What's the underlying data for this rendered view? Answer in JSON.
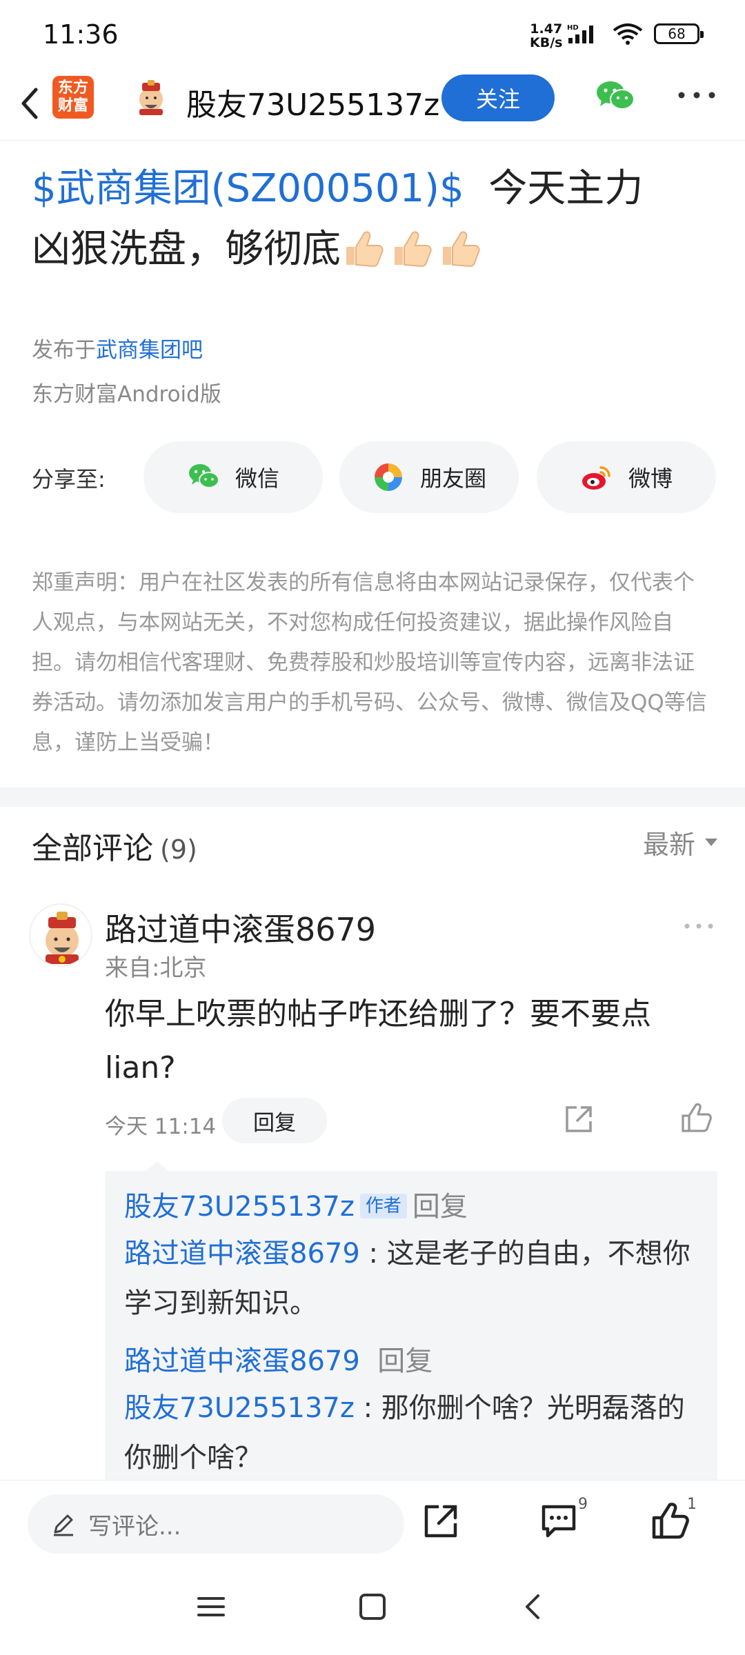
{
  "status": {
    "time": "11:36",
    "net_speed_value": "1.47",
    "net_speed_unit": "KB/s",
    "battery": "68"
  },
  "header": {
    "username": "股友73U255137z",
    "follow_label": "关注",
    "logo_line1": "东方",
    "logo_line2": "财富"
  },
  "post": {
    "stock_tag": "$武商集团(SZ000501)$",
    "title_text_1": "今天主力",
    "title_text_2": "凶狠洗盘，够彻底",
    "posted_in_prefix": "发布于",
    "forum": "武商集团吧",
    "client": "东方财富Android版"
  },
  "share": {
    "label": "分享至:",
    "targets": [
      {
        "label": "微信",
        "icon": "wechat-icon"
      },
      {
        "label": "朋友圈",
        "icon": "moments-icon"
      },
      {
        "label": "微博",
        "icon": "weibo-icon"
      }
    ]
  },
  "disclaimer": "郑重声明：用户在社区发表的所有信息将由本网站记录保存，仅代表个人观点，与本网站无关，不对您构成任何投资建议，据此操作风险自担。请勿相信代客理财、免费荐股和炒股培训等宣传内容，远离非法证券活动。请勿添加发言用户的手机号码、公众号、微博、微信及QQ等信息，谨防上当受骗！",
  "comments": {
    "title": "全部评论",
    "count": "(9)",
    "sort": "最新",
    "items": [
      {
        "user": "路过道中滚蛋8679",
        "location": "来自:北京",
        "text": "你早上吹票的帖子咋还给删了？要不要点lian?",
        "time": "今天 11:14",
        "reply_label": "回复",
        "replies": [
          {
            "from": "股友73U255137z",
            "badge": "作者",
            "action": "回复"
          },
          {
            "from": "路过道中滚蛋8679",
            "sep": ":",
            "text": "这是老子的自由，不想你学习到新知识。"
          },
          {
            "from": "路过道中滚蛋8679",
            "action": "回复"
          },
          {
            "from": "股友73U255137z",
            "sep": ":",
            "text": "那你删个啥？光明磊落的你删个啥？"
          }
        ]
      }
    ]
  },
  "bottom_bar": {
    "placeholder": "写评论...",
    "comment_count": "9",
    "like_count": "1"
  },
  "colors": {
    "accent": "#1f6fd6",
    "brand": "#f05a22",
    "muted": "#888888"
  }
}
